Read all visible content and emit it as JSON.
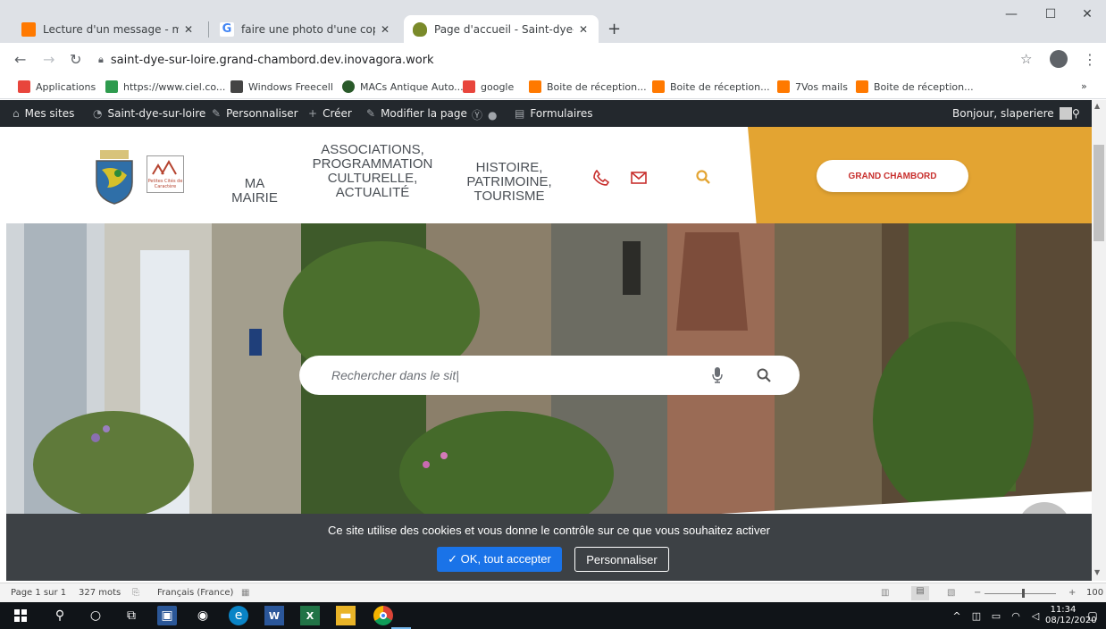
{
  "browser": {
    "tabs": [
      {
        "title": "Lecture d'un message - mail Ora",
        "favicon_color": "#ff7900"
      },
      {
        "title": "faire une photo d'une copie d'éc",
        "favicon_color": "#4285f4"
      },
      {
        "title": "Page d'accueil - Saint-dye-sur-lo",
        "favicon_color": "#7a8a2a"
      }
    ],
    "new_tab": "+",
    "url": "saint-dye-sur-loire.grand-chambord.dev.inovagora.work",
    "bookmarks": [
      {
        "label": "Applications",
        "color": "#e8453c"
      },
      {
        "label": "https://www.ciel.co...",
        "color": "#2e9b4e"
      },
      {
        "label": "Windows Freecell",
        "color": "#444444"
      },
      {
        "label": "MACs Antique Auto...",
        "color": "#2a5a2a"
      },
      {
        "label": "google",
        "color": "#e8453c"
      },
      {
        "label": "Boite de réception...",
        "color": "#ff7900"
      },
      {
        "label": "Boite de réception...",
        "color": "#ff7900"
      },
      {
        "label": "7Vos mails",
        "color": "#ff7900"
      },
      {
        "label": "Boite de réception...",
        "color": "#ff7900"
      }
    ],
    "bookmarks_more": "»"
  },
  "wp_admin": {
    "items": [
      "Mes sites",
      "Saint-dye-sur-loire",
      "Personnaliser",
      "Créer",
      "Modifier la page",
      "Formulaires"
    ],
    "greeting": "Bonjour, slaperiere"
  },
  "site": {
    "nav": [
      {
        "label": "MA\nMAIRIE"
      },
      {
        "label": "ASSOCIATIONS,\nPROGRAMMATION\nCULTURELLE,\nACTUALITÉ"
      },
      {
        "label": "HISTOIRE,\nPATRIMOINE,\nTOURISME"
      }
    ],
    "cta": "GRAND CHAMBORD",
    "logo_badge_text": "Petites Cités de Caractère",
    "search_placeholder": "Rechercher dans le sit|",
    "accent_color": "#e3a432",
    "brand_red": "#c8302e"
  },
  "cookie": {
    "message": "Ce site utilise des cookies et vous donne le contrôle sur ce que vous souhaitez activer",
    "accept": "✓ OK, tout accepter",
    "customize": "Personnaliser"
  },
  "word_status": {
    "page": "Page 1 sur 1",
    "words": "327 mots",
    "language": "Français (France)",
    "zoom": "100"
  },
  "taskbar": {
    "time": "11:34",
    "date": "08/12/2020"
  }
}
